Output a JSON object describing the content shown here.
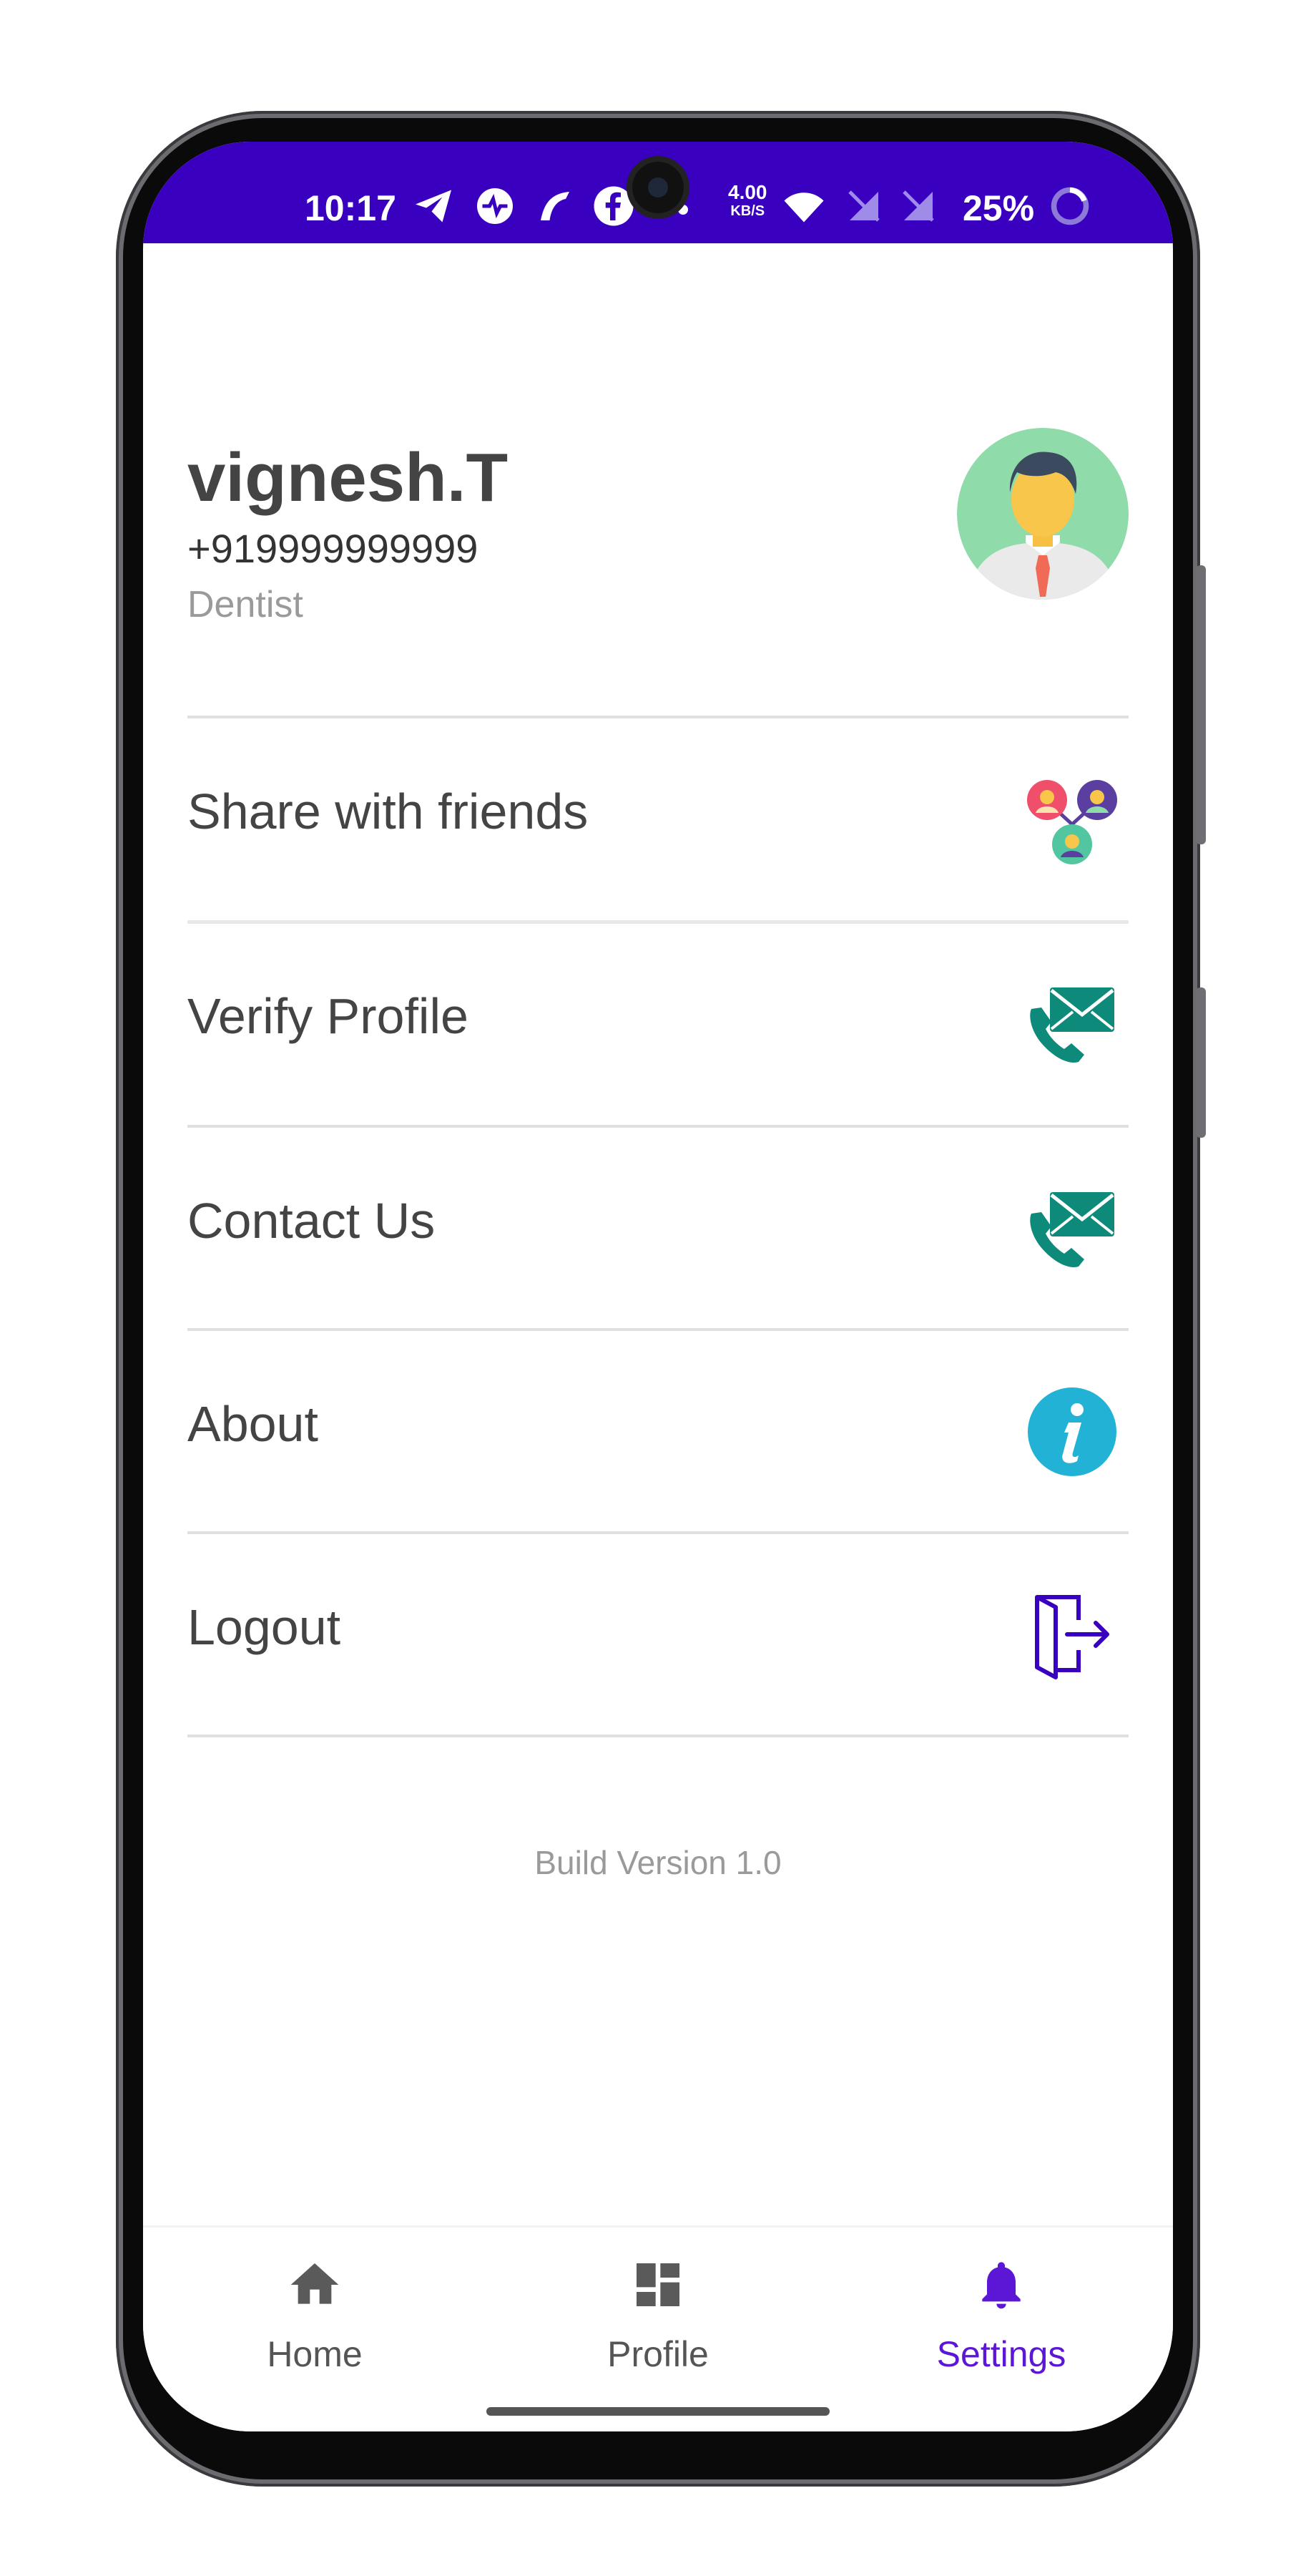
{
  "status_bar": {
    "time": "10:17",
    "speed_value": "4.00",
    "speed_unit": "KB/S",
    "battery": "25%"
  },
  "profile": {
    "name": "vignesh.T",
    "phone": "+919999999999",
    "role": "Dentist"
  },
  "menu": {
    "items": [
      {
        "label": "Share with friends",
        "icon": "share-network-icon"
      },
      {
        "label": "Verify Profile",
        "icon": "phone-mail-icon"
      },
      {
        "label": "Contact Us",
        "icon": "phone-mail-icon"
      },
      {
        "label": "About",
        "icon": "info-icon"
      },
      {
        "label": "Logout",
        "icon": "logout-icon"
      }
    ]
  },
  "footer": {
    "build_version": "Build Version 1.0"
  },
  "bottom_nav": {
    "items": [
      {
        "label": "Home",
        "icon": "home-icon"
      },
      {
        "label": "Profile",
        "icon": "dashboard-icon"
      },
      {
        "label": "Settings",
        "icon": "bell-icon",
        "active": true
      }
    ]
  },
  "colors": {
    "status_bar": "#3a00c0",
    "accent": "#5b16d6",
    "teal_icon": "#0e8a7a",
    "info_icon": "#22b2d6"
  }
}
